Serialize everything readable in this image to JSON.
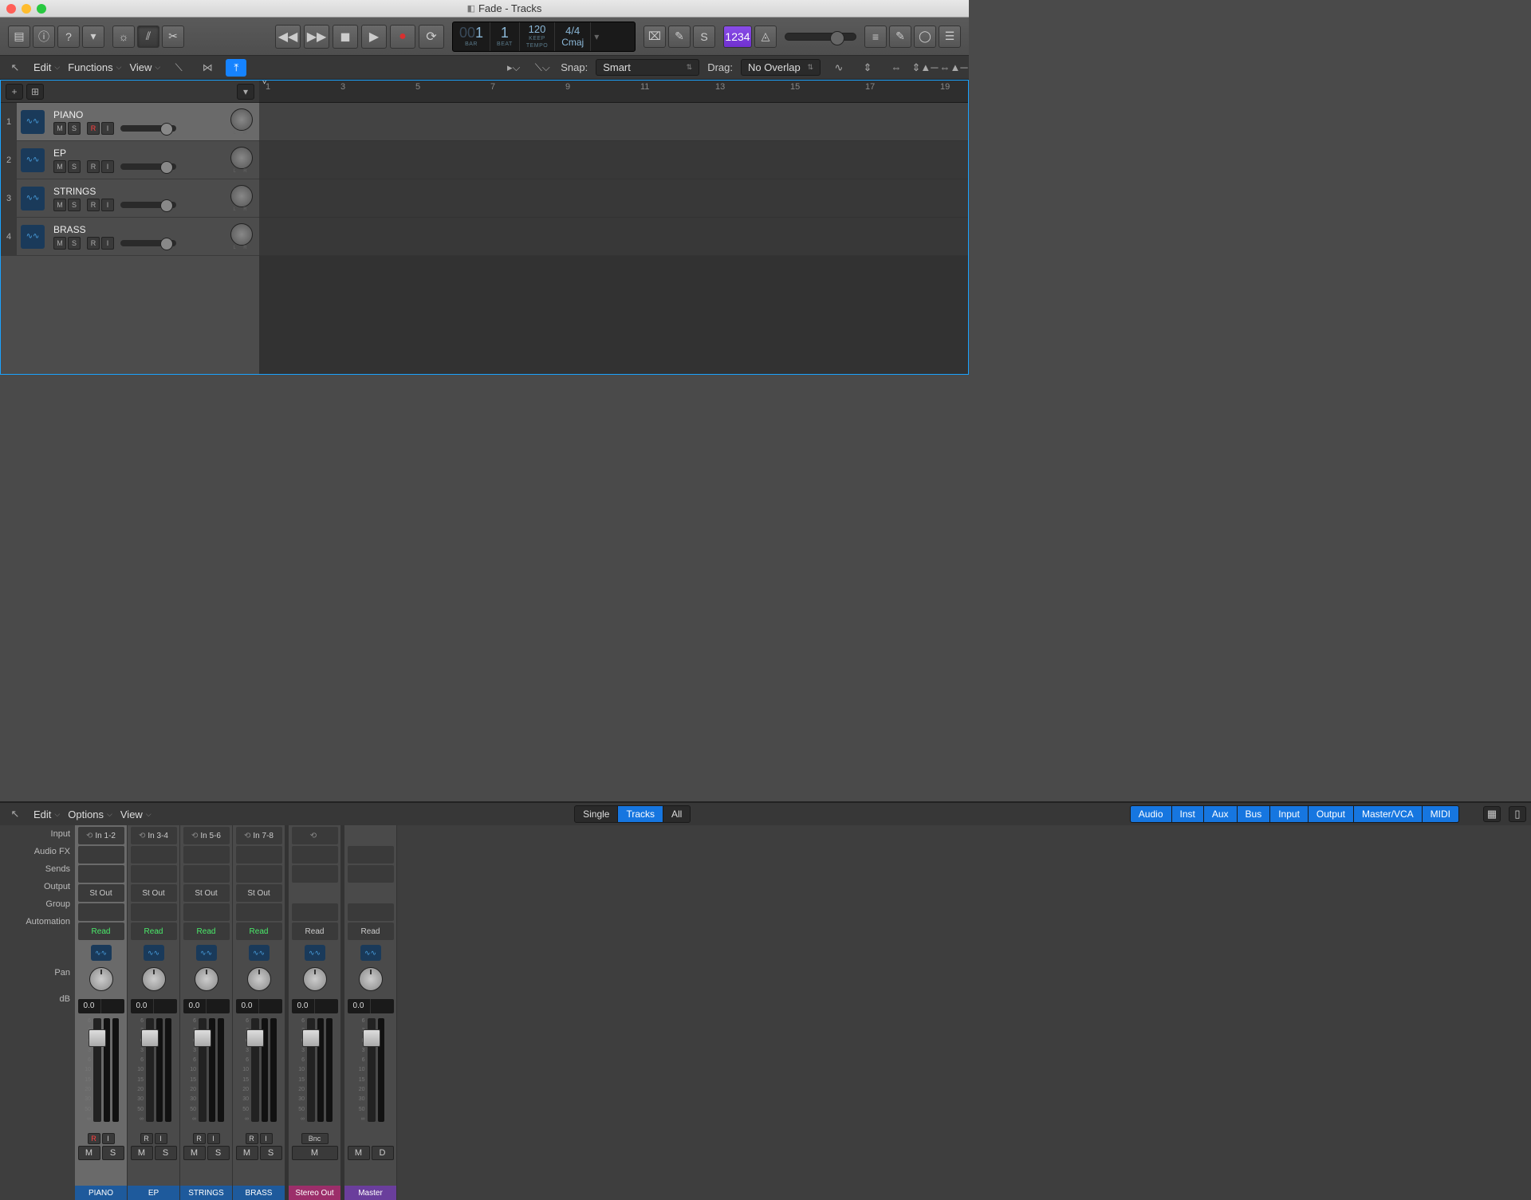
{
  "window_title": "Fade - Tracks",
  "lcd": {
    "bar_dim": "00",
    "bar": "1",
    "bar_label": "BAR",
    "beat": "1",
    "beat_label": "BEAT",
    "tempo": "120",
    "tempo_sub": "KEEP",
    "tempo_label": "TEMPO",
    "sig": "4/4",
    "key": "Cmaj"
  },
  "purple_btn": "1234",
  "editor_menus": {
    "edit": "Edit",
    "functions": "Functions",
    "view": "View"
  },
  "snap_label": "Snap:",
  "snap_value": "Smart",
  "drag_label": "Drag:",
  "drag_value": "No Overlap",
  "ruler_marks": [
    1,
    3,
    5,
    7,
    9,
    11,
    13,
    15,
    17,
    19
  ],
  "tracks": [
    {
      "num": 1,
      "name": "PIANO",
      "rec": true,
      "sel": true
    },
    {
      "num": 2,
      "name": "EP",
      "rec": false,
      "sel": false
    },
    {
      "num": 3,
      "name": "STRINGS",
      "rec": false,
      "sel": false
    },
    {
      "num": 4,
      "name": "BRASS",
      "rec": false,
      "sel": false
    }
  ],
  "track_btns": {
    "m": "M",
    "s": "S",
    "r": "R",
    "i": "I"
  },
  "mixer_menus": {
    "edit": "Edit",
    "options": "Options",
    "view": "View"
  },
  "filter_group1": [
    {
      "l": "Single",
      "a": false
    },
    {
      "l": "Tracks",
      "a": true
    },
    {
      "l": "All",
      "a": false
    }
  ],
  "filter_group2": [
    {
      "l": "Audio",
      "a": true
    },
    {
      "l": "Inst",
      "a": true
    },
    {
      "l": "Aux",
      "a": true
    },
    {
      "l": "Bus",
      "a": true
    },
    {
      "l": "Input",
      "a": true
    },
    {
      "l": "Output",
      "a": true
    },
    {
      "l": "Master/VCA",
      "a": true
    },
    {
      "l": "MIDI",
      "a": true
    }
  ],
  "mixer_row_labels": [
    "Input",
    "Audio FX",
    "Sends",
    "Output",
    "Group",
    "Automation",
    "",
    "Pan",
    "dB"
  ],
  "channels": [
    {
      "name": "PIANO",
      "input": "In 1-2",
      "output": "St Out",
      "auto": "Read",
      "auto_green": true,
      "db": "0.0",
      "rec": true,
      "type": "track",
      "color": "blue",
      "sel": true
    },
    {
      "name": "EP",
      "input": "In 3-4",
      "output": "St Out",
      "auto": "Read",
      "auto_green": true,
      "db": "0.0",
      "rec": false,
      "type": "track",
      "color": "blue",
      "sel": false
    },
    {
      "name": "STRINGS",
      "input": "In 5-6",
      "output": "St Out",
      "auto": "Read",
      "auto_green": true,
      "db": "0.0",
      "rec": false,
      "type": "track",
      "color": "blue",
      "sel": false
    },
    {
      "name": "BRASS",
      "input": "In 7-8",
      "output": "St Out",
      "auto": "Read",
      "auto_green": true,
      "db": "0.0",
      "rec": false,
      "type": "track",
      "color": "blue",
      "sel": false
    },
    {
      "name": "Stereo Out",
      "auto": "Read",
      "auto_green": false,
      "db": "0.0",
      "type": "output",
      "color": "magenta",
      "bnc": "Bnc"
    },
    {
      "name": "Master",
      "auto": "Read",
      "auto_green": false,
      "db": "0.0",
      "type": "master",
      "color": "purple"
    }
  ],
  "ch_btns": {
    "m": "M",
    "s": "S",
    "d": "D",
    "r": "R",
    "i": "I"
  },
  "scale_vals": [
    "6",
    "3",
    "0",
    "3",
    "6",
    "10",
    "15",
    "20",
    "30",
    "50",
    "∞"
  ]
}
